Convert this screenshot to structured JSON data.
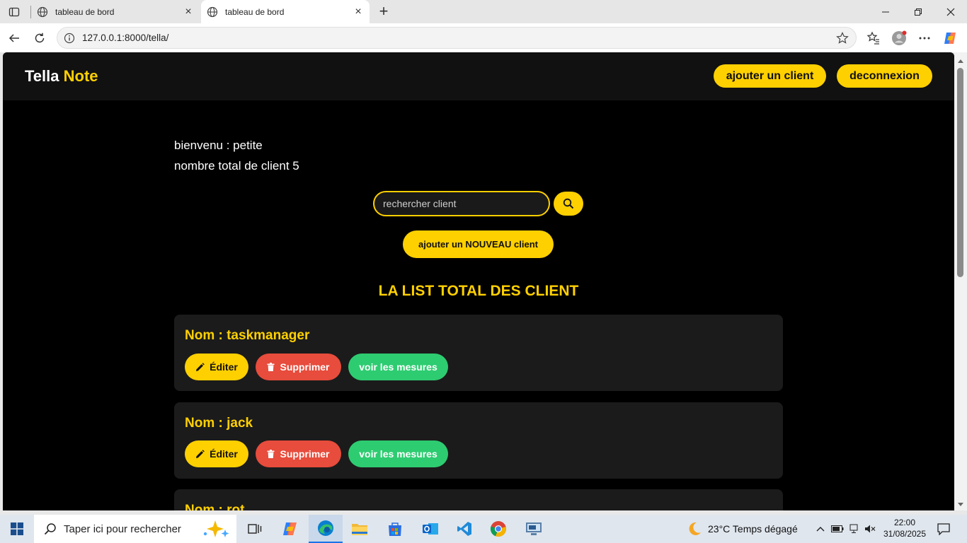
{
  "browser": {
    "tabs": [
      {
        "title": "tableau de bord",
        "active": false
      },
      {
        "title": "tableau de bord",
        "active": true
      }
    ],
    "url": "127.0.0.1:8000/tella/"
  },
  "header": {
    "brand_first": "Tella",
    "brand_second": "Note",
    "add_client_label": "ajouter un client",
    "logout_label": "deconnexion"
  },
  "main": {
    "welcome": "bienvenu : petite",
    "total_clients": "nombre total de client 5",
    "search_placeholder": "rechercher client",
    "new_client_label": "ajouter un NOUVEAU client",
    "list_title": "LA LIST TOTAL DES CLIENT",
    "clients": [
      {
        "name": "Nom : taskmanager"
      },
      {
        "name": "Nom : jack"
      },
      {
        "name": "Nom : rot"
      }
    ],
    "edit_label": "Éditer",
    "delete_label": "Supprimer",
    "view_label": "voir les mesures"
  },
  "colors": {
    "accent": "#ffd000",
    "danger": "#e74c3c",
    "success": "#2ecc71",
    "background": "#000000",
    "header": "#111111",
    "card": "#1b1b1b"
  },
  "taskbar": {
    "search_placeholder": "Taper ici pour rechercher",
    "weather": "23°C  Temps dégagé",
    "time": "22:00",
    "date": "31/08/2025"
  }
}
